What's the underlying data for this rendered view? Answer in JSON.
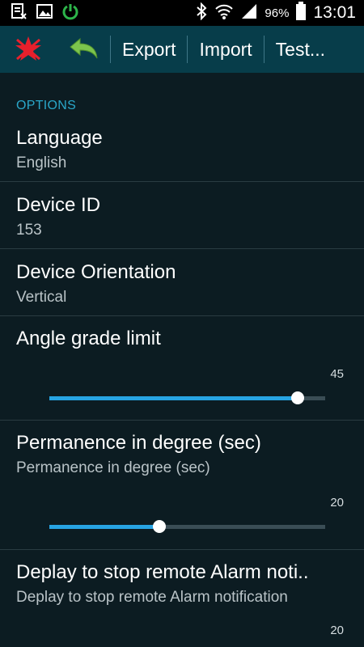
{
  "status_bar": {
    "battery": "96%",
    "time": "13:01",
    "icons": [
      "sim-card-icon",
      "image-icon",
      "power-icon",
      "bluetooth-icon",
      "wifi-icon",
      "signal-icon",
      "battery-icon"
    ]
  },
  "action_bar": {
    "icons": [
      "cancel-star-icon",
      "undo-arrow-icon"
    ],
    "buttons": [
      "Export",
      "Import",
      "Test..."
    ]
  },
  "section": {
    "title": "OPTIONS"
  },
  "prefs": {
    "language": {
      "title": "Language",
      "summary": "English"
    },
    "device_id": {
      "title": "Device ID",
      "summary": "153"
    },
    "orientation": {
      "title": "Device Orientation",
      "summary": "Vertical"
    },
    "angle": {
      "title": "Angle grade limit",
      "value": "45",
      "fraction": 0.9
    },
    "permanence": {
      "title": "Permanence in degree (sec)",
      "summary": "Permanence in degree (sec)",
      "value": "20",
      "fraction": 0.4
    },
    "deplay": {
      "title": "Deplay to stop remote Alarm noti..",
      "summary": "Deplay to stop remote Alarm notification",
      "value": "20"
    }
  },
  "colors": {
    "action_bar": "#073d4a",
    "background": "#0c1c22",
    "accent": "#2aa7c9",
    "slider": "#27a4e3"
  }
}
